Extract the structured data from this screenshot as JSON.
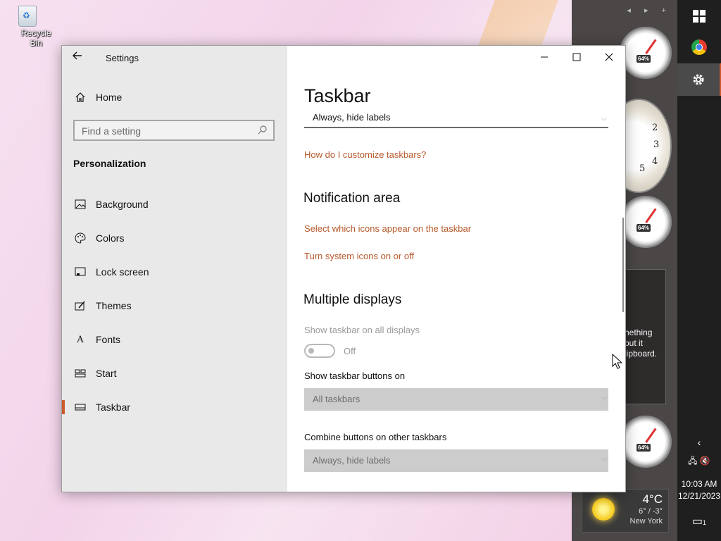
{
  "desktop": {
    "recycle_bin_label": "Recycle Bin"
  },
  "gadgets": {
    "gauge_percent": "64%",
    "clock_numbers": [
      "2",
      "3",
      "4",
      "5"
    ],
    "clipboard_text": [
      "nething",
      "put it",
      "lipboard."
    ],
    "weather": {
      "temp": "4°C",
      "range": "6° / -3°",
      "city": "New York"
    }
  },
  "taskbar": {
    "time": "10:03 AM",
    "date": "12/21/2023",
    "notification_count": "1",
    "accent_color": "#cc5a2c"
  },
  "window": {
    "app_title": "Settings",
    "minimize_glyph": "—",
    "maximize_glyph": "☐",
    "close_glyph": "✕"
  },
  "sidebar": {
    "home_label": "Home",
    "search_placeholder": "Find a setting",
    "section_title": "Personalization",
    "items": [
      {
        "label": "Background",
        "icon": "image-icon"
      },
      {
        "label": "Colors",
        "icon": "palette-icon"
      },
      {
        "label": "Lock screen",
        "icon": "lock-screen-icon"
      },
      {
        "label": "Themes",
        "icon": "themes-icon"
      },
      {
        "label": "Fonts",
        "icon": "fonts-icon"
      },
      {
        "label": "Start",
        "icon": "start-icon"
      },
      {
        "label": "Taskbar",
        "icon": "taskbar-icon",
        "selected": true
      }
    ]
  },
  "content": {
    "page_title": "Taskbar",
    "top_dropdown_value": "Always, hide labels",
    "customize_link": "How do I customize taskbars?",
    "notification_area_heading": "Notification area",
    "select_icons_link": "Select which icons appear on the taskbar",
    "system_icons_link": "Turn system icons on or off",
    "multiple_displays_heading": "Multiple displays",
    "show_all_displays_label": "Show taskbar on all displays",
    "show_all_displays_state": "Off",
    "show_buttons_on_label": "Show taskbar buttons on",
    "show_buttons_on_value": "All taskbars",
    "combine_buttons_label": "Combine buttons on other taskbars",
    "combine_buttons_value": "Always, hide labels",
    "link_color": "#b75a2c"
  }
}
